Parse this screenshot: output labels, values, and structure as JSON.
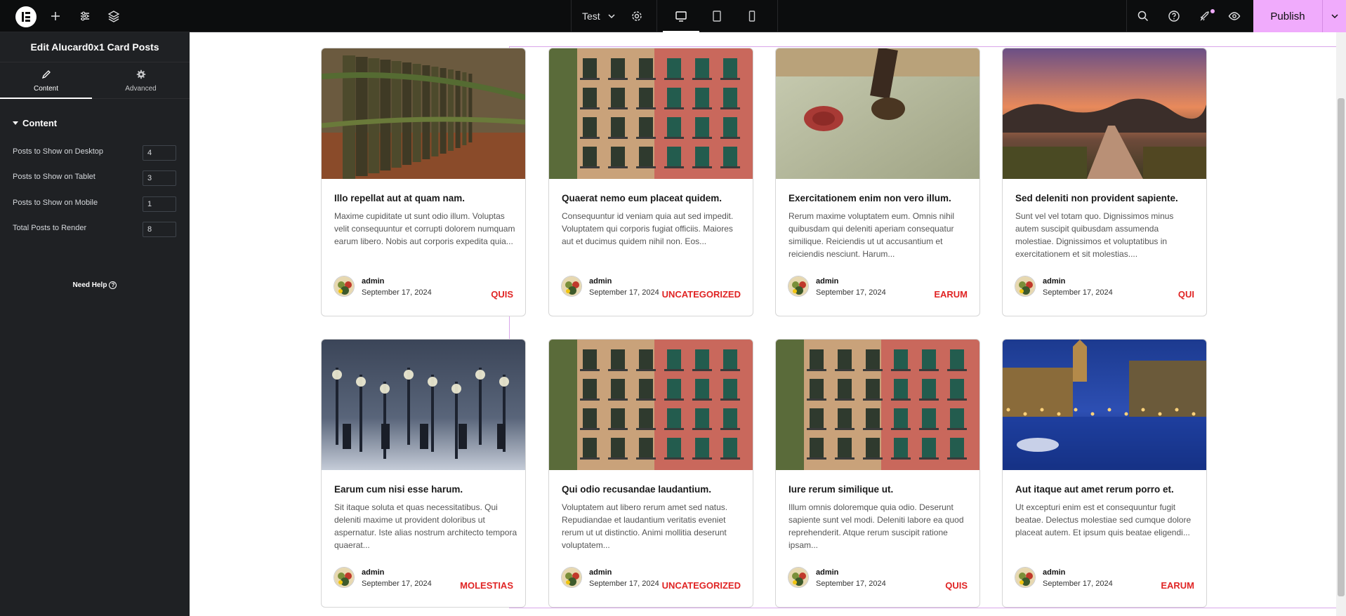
{
  "topbar": {
    "page_name": "Test",
    "publish_label": "Publish"
  },
  "panel": {
    "title": "Edit Alucard0x1 Card Posts",
    "tabs": [
      {
        "label": "Content",
        "icon": "pencil-icon"
      },
      {
        "label": "Advanced",
        "icon": "gear-icon"
      }
    ],
    "section": "Content",
    "fields": [
      {
        "label": "Posts to Show on Desktop",
        "value": "4"
      },
      {
        "label": "Posts to Show on Tablet",
        "value": "3"
      },
      {
        "label": "Posts to Show on Mobile",
        "value": "1"
      },
      {
        "label": "Total Posts to Render",
        "value": "8"
      }
    ],
    "need_help": "Need Help"
  },
  "posts": [
    {
      "title": "Illo repellat aut at quam nam.",
      "excerpt": "Maxime cupiditate ut sunt odio illum. Voluptas velit consequuntur et corrupti dolorem numquam earum libero. Nobis aut corporis expedita quia...",
      "author": "admin",
      "date": "September 17, 2024",
      "category": "QUIS",
      "image": "fence"
    },
    {
      "title": "Quaerat nemo eum placeat quidem.",
      "excerpt": "Consequuntur id veniam quia aut sed impedit. Voluptatem qui corporis fugiat officiis. Maiores aut et ducimus quidem nihil non. Eos...",
      "author": "admin",
      "date": "September 17, 2024",
      "category": "UNCATEGORIZED",
      "image": "building"
    },
    {
      "title": "Exercitationem enim non vero illum.",
      "excerpt": "Rerum maxime voluptatem eum. Omnis nihil quibusdam qui deleniti aperiam consequatur similique. Reiciendis ut ut accusantium et reiciendis nesciunt. Harum...",
      "author": "admin",
      "date": "September 17, 2024",
      "category": "EARUM",
      "image": "seal"
    },
    {
      "title": "Sed deleniti non provident sapiente.",
      "excerpt": "Sunt vel vel totam quo. Dignissimos minus autem suscipit quibusdam assumenda molestiae. Dignissimos et voluptatibus in exercitationem et sit molestias....",
      "author": "admin",
      "date": "September 17, 2024",
      "category": "QUI",
      "image": "sunset"
    },
    {
      "title": "Earum cum nisi esse harum.",
      "excerpt": "Sit itaque soluta et quas necessitatibus. Qui deleniti maxime ut provident doloribus ut aspernatur. Iste alias nostrum architecto tempora quaerat...",
      "author": "admin",
      "date": "September 17, 2024",
      "category": "MOLESTIAS",
      "image": "snow"
    },
    {
      "title": "Qui odio recusandae laudantium.",
      "excerpt": "Voluptatem aut libero rerum amet sed natus. Repudiandae et laudantium veritatis eveniet rerum ut ut distinctio. Animi mollitia deserunt voluptatem...",
      "author": "admin",
      "date": "September 17, 2024",
      "category": "UNCATEGORIZED",
      "image": "building"
    },
    {
      "title": "Iure rerum similique ut.",
      "excerpt": "Illum omnis doloremque quia odio. Deserunt sapiente sunt vel modi. Deleniti labore ea quod reprehenderit. Atque rerum suscipit ratione ipsam...",
      "author": "admin",
      "date": "September 17, 2024",
      "category": "QUIS",
      "image": "building"
    },
    {
      "title": "Aut itaque aut amet rerum porro et.",
      "excerpt": "Ut excepturi enim est et consequuntur fugit beatae. Delectus molestiae sed cumque dolore placeat autem. Et ipsum quis beatae eligendi...",
      "author": "admin",
      "date": "September 17, 2024",
      "category": "EARUM",
      "image": "canal"
    }
  ]
}
